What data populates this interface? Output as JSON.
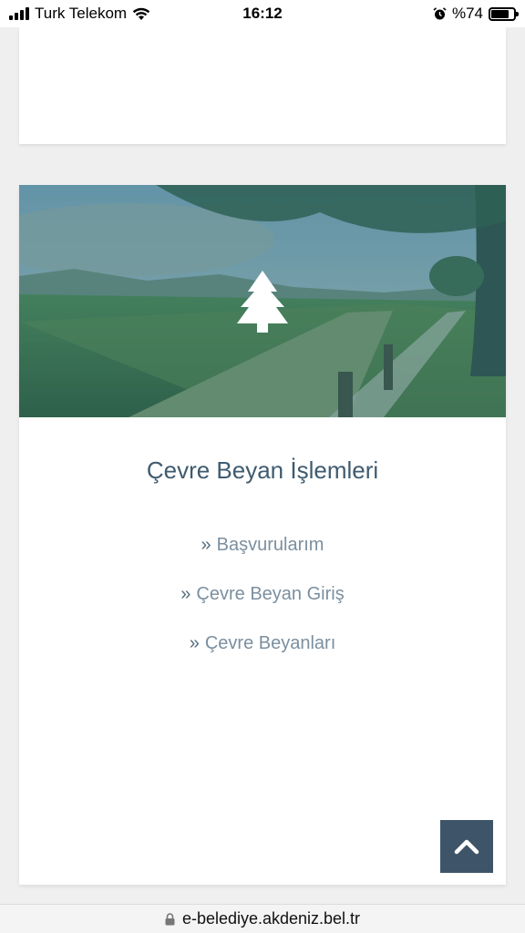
{
  "status_bar": {
    "carrier": "Turk Telekom",
    "time": "16:12",
    "battery_percent": "%74",
    "battery_level": 0.74
  },
  "card": {
    "banner_icon": "tree-icon",
    "title": "Çevre Beyan İşlemleri",
    "links": [
      {
        "label": "Başvurularım"
      },
      {
        "label": "Çevre Beyan Giriş"
      },
      {
        "label": "Çevre Beyanları"
      }
    ]
  },
  "url_bar": {
    "url": "e-belediye.akdeniz.bel.tr",
    "icon": "lock-icon"
  },
  "colors": {
    "title": "#3f5b6f",
    "link": "#7b8f9f",
    "scroll_button": "#3e5468",
    "banner_overlay": "#2f6e74"
  }
}
